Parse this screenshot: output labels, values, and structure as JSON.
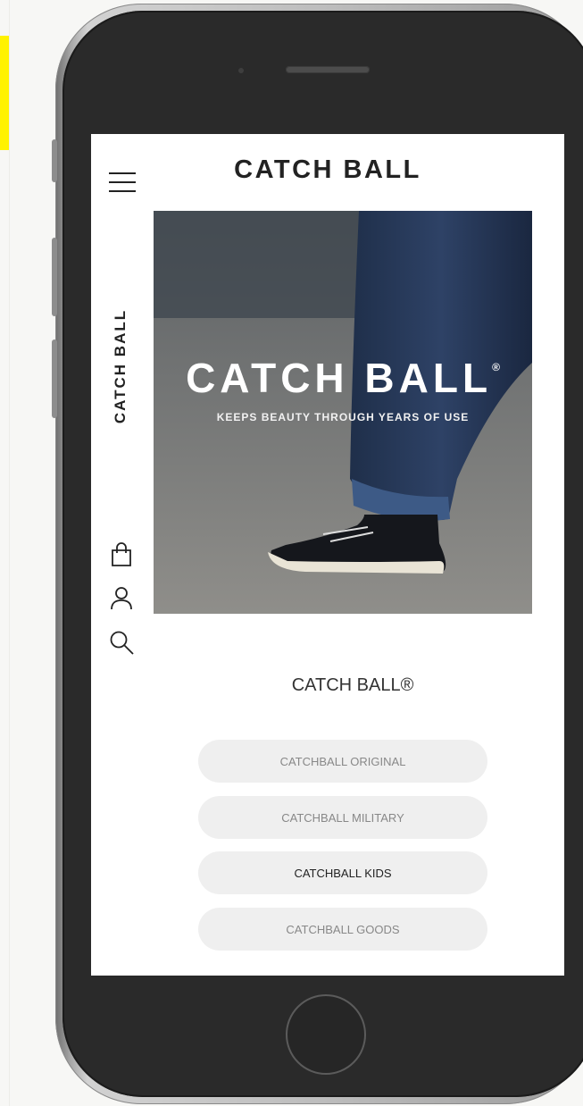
{
  "header": {
    "logo": "CATCH BALL"
  },
  "sidebar": {
    "brand_vertical": "CATCH BALL",
    "icons": [
      "menu-icon",
      "shopping-bag-icon",
      "user-icon",
      "search-icon"
    ]
  },
  "hero": {
    "title": "CATCH BALL",
    "registered": "®",
    "tagline": "KEEPS BEAUTY THROUGH YEARS OF USE"
  },
  "section": {
    "title": "CATCH BALL®"
  },
  "categories": [
    {
      "label": "CATCHBALL ORIGINAL",
      "active": false
    },
    {
      "label": "CATCHBALL MILITARY",
      "active": false
    },
    {
      "label": "CATCHBALL KIDS",
      "active": true
    },
    {
      "label": "CATCHBALL GOODS",
      "active": false
    }
  ],
  "colors": {
    "accent_yellow": "#fff200",
    "button_bg": "#efefef",
    "text_dark": "#222222",
    "text_muted": "#888888"
  }
}
